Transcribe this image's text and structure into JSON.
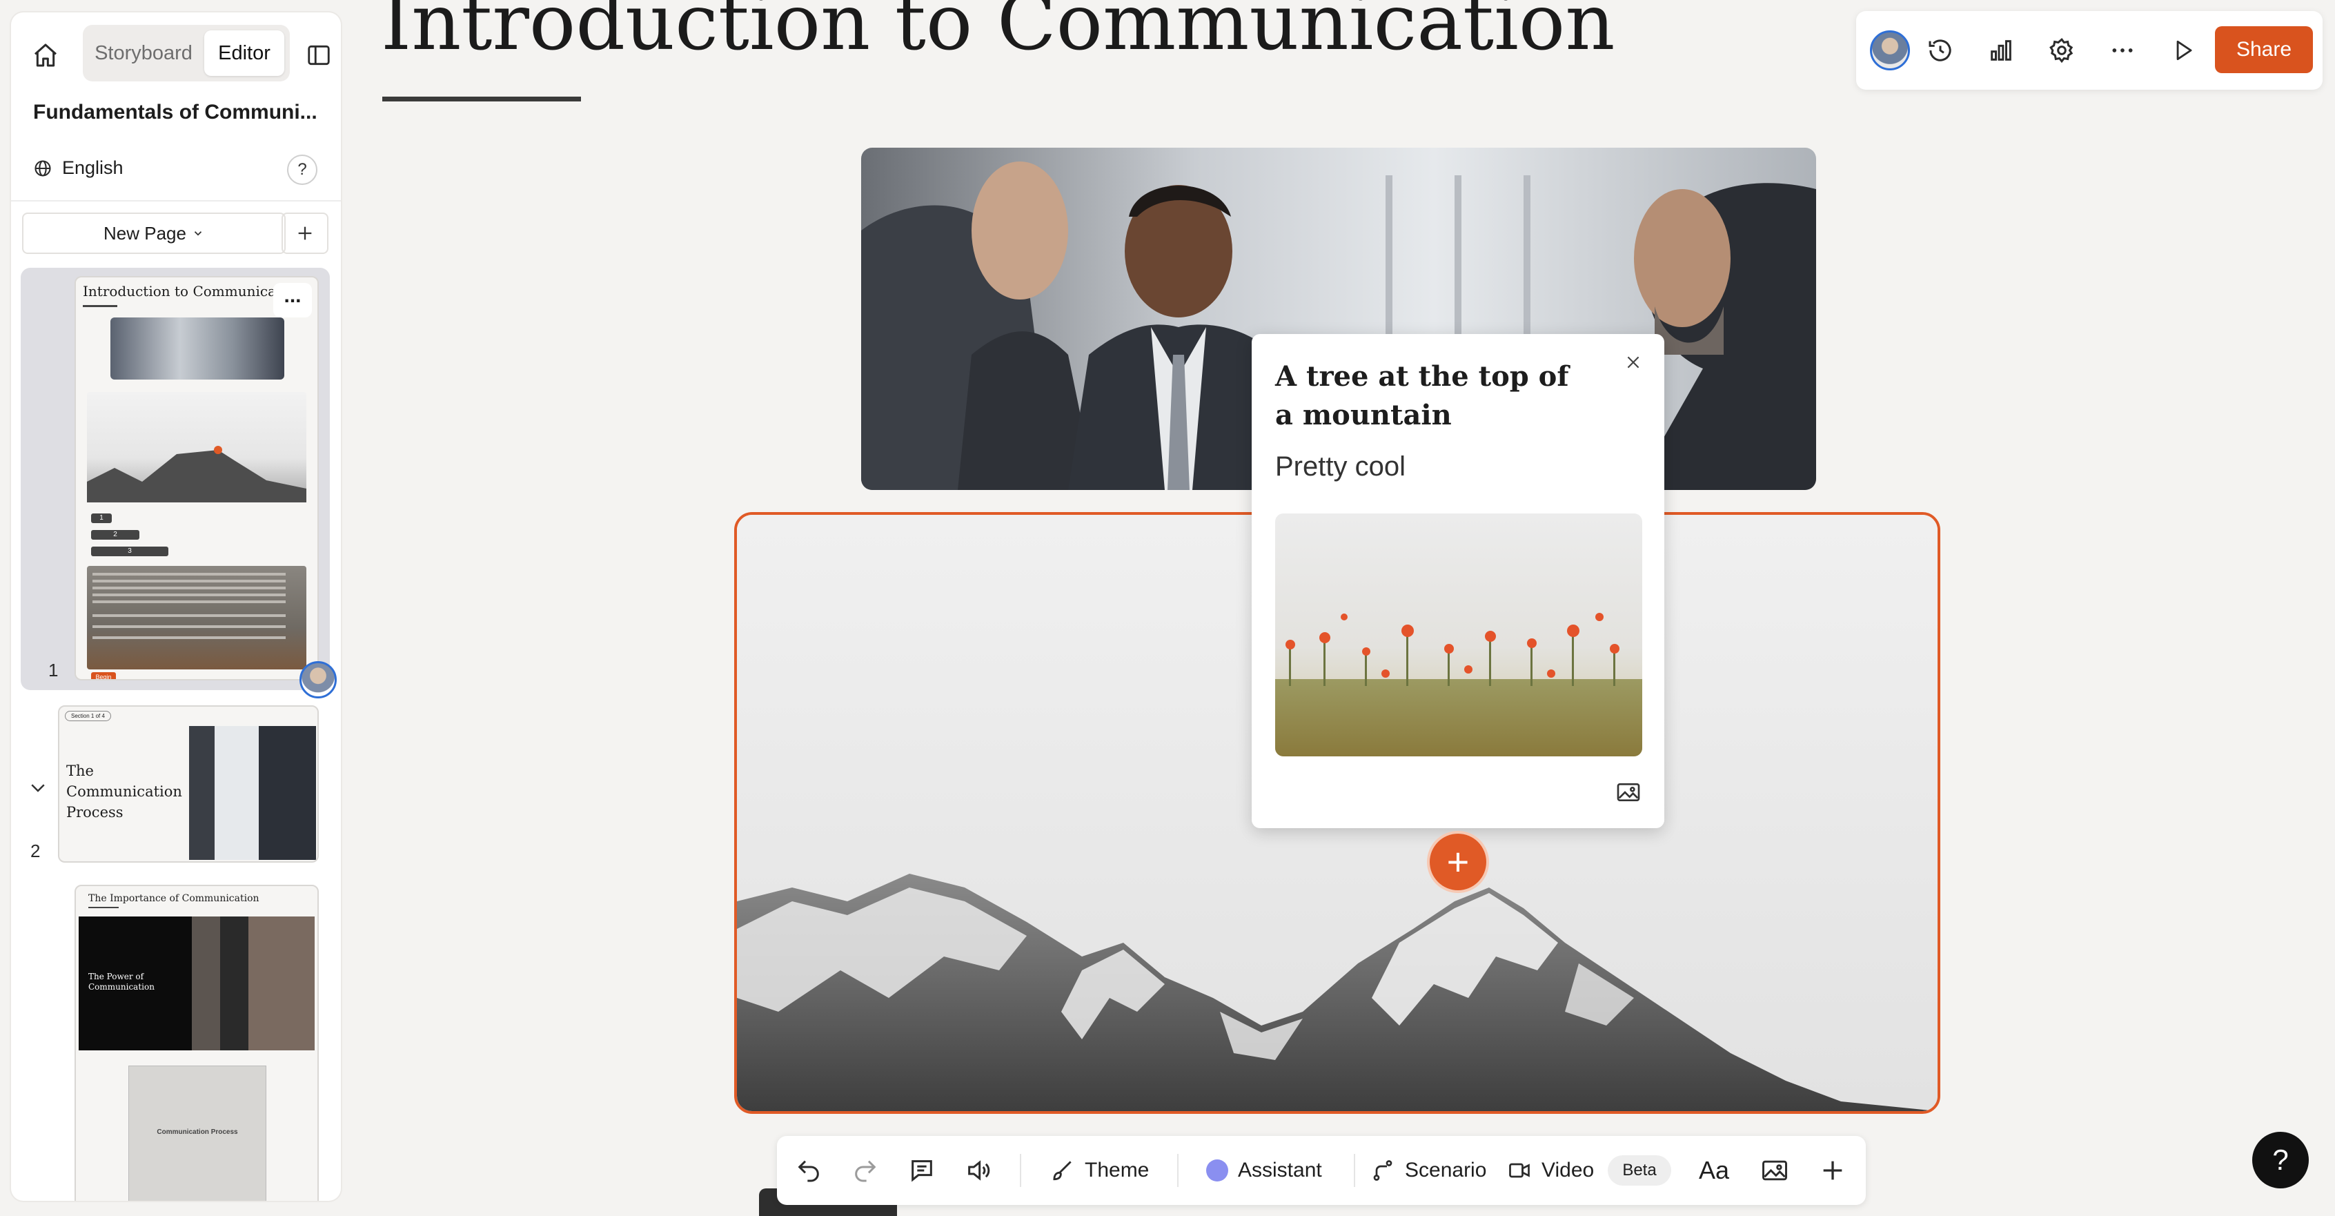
{
  "sidebar": {
    "tabs": {
      "storyboard": "Storyboard",
      "editor": "Editor"
    },
    "project_title": "Fundamentals of Communi...",
    "language": "English",
    "help": "?",
    "new_page_label": "New Page",
    "add_label": "+",
    "pages": [
      {
        "number": "1",
        "title": "Introduction to Communicati",
        "menu": "...",
        "button": "Begin",
        "list": [
          "1",
          "2",
          "3"
        ]
      },
      {
        "number": "2",
        "title": "The Communication Process",
        "badge": "Section 1 of 4"
      },
      {
        "number": "",
        "title": "The Importance of Communication",
        "video_title": "The Power of Communication",
        "card_label": "Communication Process"
      }
    ]
  },
  "main": {
    "title": "Introduction to Communication"
  },
  "popup": {
    "title": "A tree at the top of a mountain",
    "body": "Pretty cool"
  },
  "hotspot": {
    "symbol": "+"
  },
  "toolbar": {
    "share": "Share",
    "icons": [
      "avatar",
      "history-icon",
      "analytics-icon",
      "settings-icon",
      "more-icon",
      "play-icon"
    ]
  },
  "bottom_toolbar": {
    "theme": "Theme",
    "assistant": "Assistant",
    "scenario": "Scenario",
    "video": "Video",
    "beta": "Beta",
    "text": "Aa"
  },
  "help_button": "?",
  "colors": {
    "accent": "#d9531e",
    "hotspot": "#e05a26",
    "assistant_dot": "#8a8ff0"
  }
}
